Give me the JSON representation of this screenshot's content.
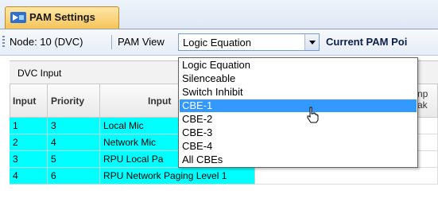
{
  "tab": {
    "label": "PAM Settings",
    "icon": "pam-settings-icon"
  },
  "toolbar": {
    "node_label": "Node: 10 (DVC)",
    "view_label": "PAM View",
    "view_value": "Logic Equation",
    "current_label": "Current PAM Poi"
  },
  "grid": {
    "group_label": "DVC Input",
    "columns": [
      "Input",
      "Priority",
      "Input",
      "np",
      "ak"
    ],
    "rows": [
      {
        "input": "1",
        "priority": "3",
        "name": "Local Mic"
      },
      {
        "input": "2",
        "priority": "4",
        "name": "Network Mic"
      },
      {
        "input": "3",
        "priority": "5",
        "name": "RPU Local Pa"
      },
      {
        "input": "4",
        "priority": "6",
        "name": "RPU Network Paging Level 1"
      }
    ]
  },
  "dropdown": {
    "options": [
      "Logic Equation",
      "Silenceable",
      "Switch Inhibit",
      "CBE-1",
      "CBE-2",
      "CBE-3",
      "CBE-4",
      "All CBEs"
    ],
    "selected_index": 3
  },
  "colors": {
    "row_highlight": "#00ffff",
    "selection": "#3399ff",
    "tab": "#f7c45a"
  }
}
